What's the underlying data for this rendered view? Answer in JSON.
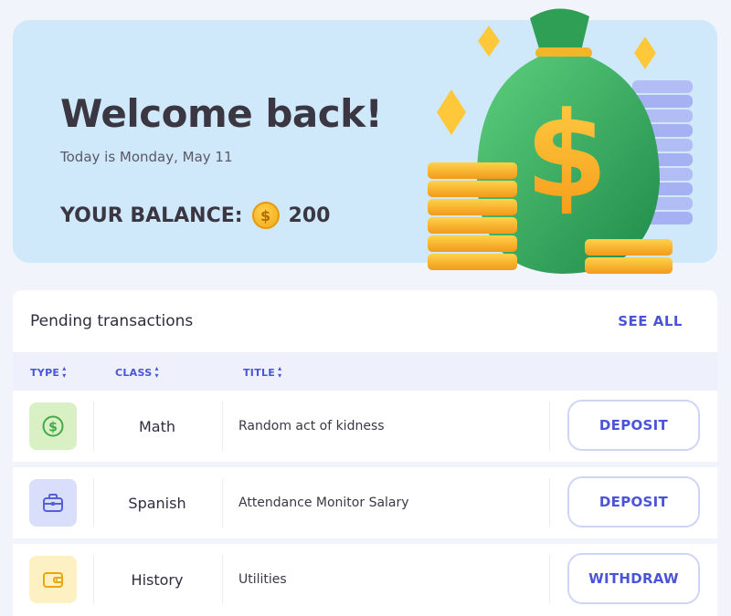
{
  "hero": {
    "title": "Welcome back!",
    "date_text": "Today is Monday, May 11",
    "balance_label": "YOUR BALANCE:",
    "balance_value": "200",
    "coin_symbol": "$"
  },
  "pending": {
    "title": "Pending transactions",
    "see_all": "SEE ALL",
    "columns": [
      {
        "label": "TYPE",
        "sort_icon": "sort-icon"
      },
      {
        "label": "CLASS",
        "sort_icon": "sort-icon"
      },
      {
        "label": "TITLE",
        "sort_icon": "sort-icon"
      }
    ],
    "rows": [
      {
        "type_icon": "dollar-circle-icon",
        "icon_bg": "#d9f0c4",
        "icon_color": "#45a84a",
        "class": "Math",
        "title": "Random act of kidness",
        "action": "DEPOSIT"
      },
      {
        "type_icon": "briefcase-icon",
        "icon_bg": "#d9defb",
        "icon_color": "#5460d6",
        "class": "Spanish",
        "title": "Attendance Monitor Salary",
        "action": "DEPOSIT"
      },
      {
        "type_icon": "wallet-icon",
        "icon_bg": "#fdf1c4",
        "icon_color": "#e9a60f",
        "class": "History",
        "title": "Utilities",
        "action": "WITHDRAW"
      }
    ]
  },
  "colors": {
    "accent": "#4a54d8",
    "hero_bg": "#cfe9fb",
    "page_bg": "#f2f4fb"
  }
}
